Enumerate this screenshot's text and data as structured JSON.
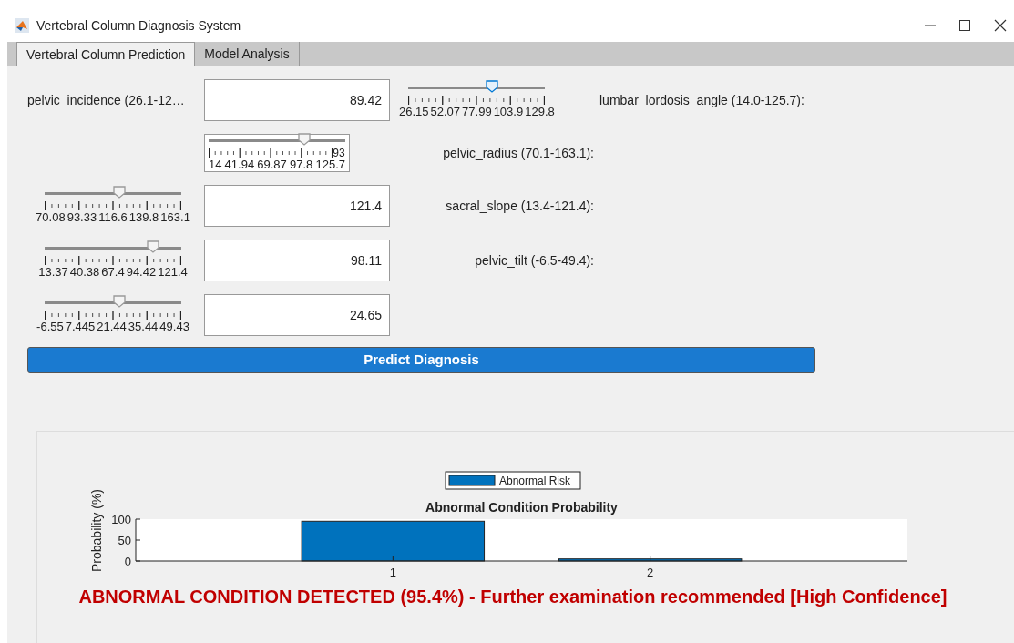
{
  "window": {
    "title": "Vertebral Column Diagnosis System"
  },
  "tabs": [
    {
      "label": "Vertebral Column Prediction",
      "selected": true
    },
    {
      "label": "Model Analysis",
      "selected": false
    }
  ],
  "inputs": {
    "label": "pelvic_incidence (26.1-12…",
    "fields": [
      "89.42",
      "121.4",
      "98.11",
      "24.65"
    ],
    "row_labels": [
      "lumbar_lordosis_angle (14.0-125.7):",
      "pelvic_radius (70.1-163.1):",
      "sacral_slope (13.4-121.4):",
      "pelvic_tilt (-6.5-49.4):"
    ],
    "sliders": [
      {
        "ticks": [
          "26.15",
          "52.07",
          "77.99",
          "103.9",
          "129.8"
        ],
        "level": 0.61,
        "focused": true
      },
      {
        "ticks": [
          "14",
          "41.94",
          "69.87",
          "97.8",
          "125.7"
        ],
        "level": 0.7,
        "focused": false,
        "overlap_text": "93"
      },
      {
        "ticks": [
          "70.08",
          "93.33",
          "116.6",
          "139.8",
          "163.1"
        ],
        "level": 0.55,
        "focused": false
      },
      {
        "ticks": [
          "13.37",
          "40.38",
          "67.4",
          "94.42",
          "121.4"
        ],
        "level": 0.79,
        "focused": false
      },
      {
        "ticks": [
          "-6.55",
          "7.445",
          "21.44",
          "35.44",
          "49.43"
        ],
        "level": 0.55,
        "focused": false
      }
    ]
  },
  "predict_button": "Predict Diagnosis",
  "results": {
    "chart_data": {
      "type": "bar",
      "title": "Abnormal Condition Probability",
      "ylabel": "Probability (%)",
      "categories": [
        "1",
        "2"
      ],
      "series": [
        {
          "name": "Abnormal Risk",
          "color": "#0072bd",
          "values": [
            95,
            5
          ]
        }
      ],
      "ylim": [
        0,
        100
      ],
      "yticks": [
        0,
        50,
        100
      ]
    },
    "message": "ABNORMAL CONDITION DETECTED (95.4%) - Further examination recommended [High Confidence]"
  }
}
